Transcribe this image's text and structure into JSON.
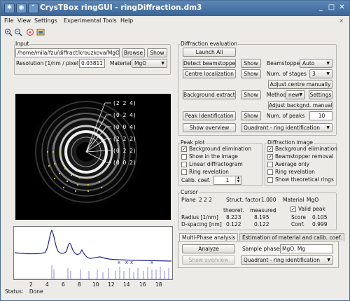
{
  "window": {
    "title": "CrysTBox ringGUI - ringDiffraction.dm3",
    "app_icon": "app-icon",
    "controls": [
      "minimize-icon",
      "maximize-icon",
      "close-icon"
    ]
  },
  "menu": [
    "File",
    "View",
    "Settings",
    "Experimental",
    "Tools",
    "Help"
  ],
  "menu_close": "×",
  "toolbar": [
    "zoom-in-icon",
    "zoom-out-icon",
    "pan-icon",
    "export-icon"
  ],
  "input": {
    "title": "Input",
    "path": "/home/mila/fzu/diffract/krouzkova/MgOMraz",
    "browse": "Browse",
    "show": "Show",
    "resolution_label": "Resolution [1/nm / pixel]",
    "resolution_value": "0.03811",
    "material_label": "Material",
    "material_value": "MgO"
  },
  "ring_labels": [
    "(2 2 4)",
    "(0 2 4)",
    "(0 0 4)",
    "(2 2 2)",
    "(0 2 2)",
    "(0 0 2)"
  ],
  "profile_axis": [
    "2",
    "4",
    "6",
    "8",
    "10",
    "12",
    "14",
    "16",
    "18"
  ],
  "status": {
    "label": "Status:",
    "value": "Done"
  },
  "diffraction_evaluation": {
    "title": "Diffraction evaluation",
    "launch_all": "Launch All",
    "detect_beamstopper": "Detect beamstopper",
    "show1": "Show",
    "beamstopper_label": "Beamstopper",
    "beamstopper_value": "Auto",
    "centre_localization": "Centre localization",
    "show2": "Show",
    "stages_label": "Num. of stages",
    "stages_value": "3",
    "adjust_centre": "Adjust centre manually",
    "background_extract": "Background extract.",
    "show3": "Show",
    "method_label": "Method",
    "method_value": "new",
    "settings": "Settings",
    "adjust_background": "Adjust backgnd. manually",
    "peak_identification": "Peak Identification",
    "show4": "Show",
    "peaks_label": "Num. of peaks",
    "peaks_value": "10",
    "show_overview": "Show overview",
    "overview_mode": "Quadrant - ring identification"
  },
  "peak_plot": {
    "title": "Peak plot",
    "items": [
      {
        "label": "Background elimination",
        "checked": true
      },
      {
        "label": "Show in the image",
        "checked": false
      },
      {
        "label": "Linear diffractogram",
        "checked": false
      },
      {
        "label": "Ring revelation",
        "checked": false
      }
    ],
    "calib_label": "Calib. coef.",
    "calib_value": "1"
  },
  "diffraction_image": {
    "title": "Diffraction image",
    "items": [
      {
        "label": "Background elimination",
        "checked": true
      },
      {
        "label": "Beamstopper removal",
        "checked": true
      },
      {
        "label": "Average only",
        "checked": false
      },
      {
        "label": "Ring revelation",
        "checked": false
      },
      {
        "label": "Show theoretical rings",
        "checked": false
      }
    ]
  },
  "cursor": {
    "title": "Cursor",
    "plane_label": "Plane",
    "plane_value": "2 2 2",
    "struct_label": "Struct. factor",
    "struct_value": "1.000",
    "material_label": "Material",
    "material_value": "MgO",
    "col_theoret": "theoret.",
    "col_measured": "measured",
    "valid_peak": "Valid peak",
    "valid_checked": true,
    "radius_label": "Radius [1/nm]",
    "radius_theoret": "8.223",
    "radius_measured": "8.195",
    "score_label": "Score",
    "score_value": "0.105",
    "dspacing_label": "D-spacing [nm]",
    "dspacing_theoret": "0.122",
    "dspacing_measured": "0.122",
    "conf_label": "Conf.",
    "conf_value": "0.999"
  },
  "tabs": {
    "multi_phase": "Multi-Phase analysis",
    "estimation": "Estimation of material and calib. coef.",
    "analyze": "Analyze",
    "sample_phases_label": "Sample phases",
    "sample_phases_value": "MgO, Mg",
    "show_overview": "Show overview",
    "overview_mode": "Quadrant - ring identification"
  },
  "colors": {
    "titlebar": "#3b6494",
    "window_bg": "#ecebe8",
    "profile_line": "#23238a",
    "marker_blue": "#3a3ad0",
    "ring_dots": "#e0d020"
  }
}
